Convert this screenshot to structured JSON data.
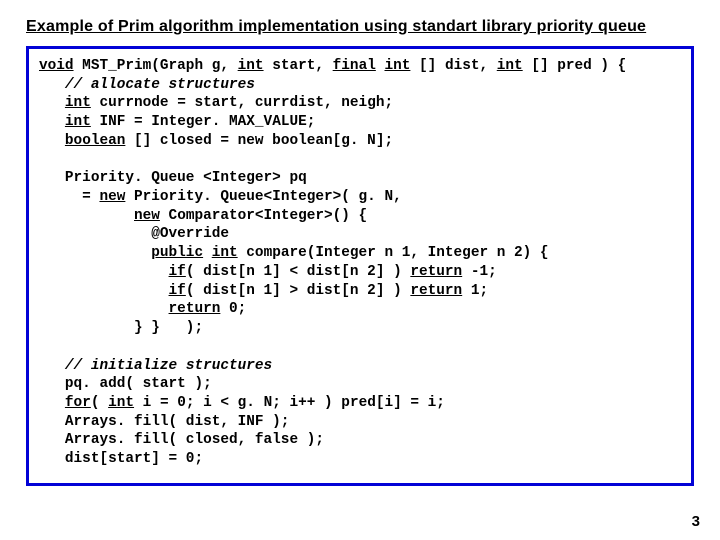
{
  "title": "Example of Prim algorithm implementation using standart library priority queue",
  "page_number": "3",
  "code": {
    "l01a": "void",
    "l01b": " MST_Prim(Graph g, ",
    "l01c": "int",
    "l01d": " start, ",
    "l01e": "final",
    "l01f": " ",
    "l01g": "int",
    "l01h": " [] dist, ",
    "l01i": "int",
    "l01j": " [] pred ) {",
    "l02a": "   ",
    "l02b": "// allocate structures",
    "l03a": "   ",
    "l03b": "int",
    "l03c": " currnode = start, currdist, neigh;",
    "l04a": "   ",
    "l04b": "int",
    "l04c": " INF = Integer. MAX_VALUE;",
    "l05a": "   ",
    "l05b": "boolean",
    "l05c": " [] closed = new boolean[g. N];",
    "blank1": " ",
    "l06": "   Priority. Queue <Integer> pq",
    "l07a": "     = ",
    "l07b": "new",
    "l07c": " Priority. Queue<Integer>( g. N,",
    "l08a": "           ",
    "l08b": "new",
    "l08c": " Comparator<Integer>() {",
    "l09": "             @Override",
    "l10a": "             ",
    "l10b": "public",
    "l10c": " ",
    "l10d": "int",
    "l10e": " compare(Integer n 1, Integer n 2) {",
    "l11a": "               ",
    "l11b": "if",
    "l11c": "( dist[n 1] < dist[n 2] ) ",
    "l11d": "return",
    "l11e": " -1;",
    "l12a": "               ",
    "l12b": "if",
    "l12c": "( dist[n 1] > dist[n 2] ) ",
    "l12d": "return",
    "l12e": " 1;",
    "l13a": "               ",
    "l13b": "return",
    "l13c": " 0;",
    "l14": "           } }   );",
    "blank2": " ",
    "l15a": "   ",
    "l15b": "// initialize structures",
    "l16": "   pq. add( start );",
    "l17a": "   ",
    "l17b": "for",
    "l17c": "( ",
    "l17d": "int",
    "l17e": " i = 0; i < g. N; i++ ) pred[i] = i;",
    "l18": "   Arrays. fill( dist, INF );",
    "l19": "   Arrays. fill( closed, false );",
    "l20": "   dist[start] = 0;"
  }
}
